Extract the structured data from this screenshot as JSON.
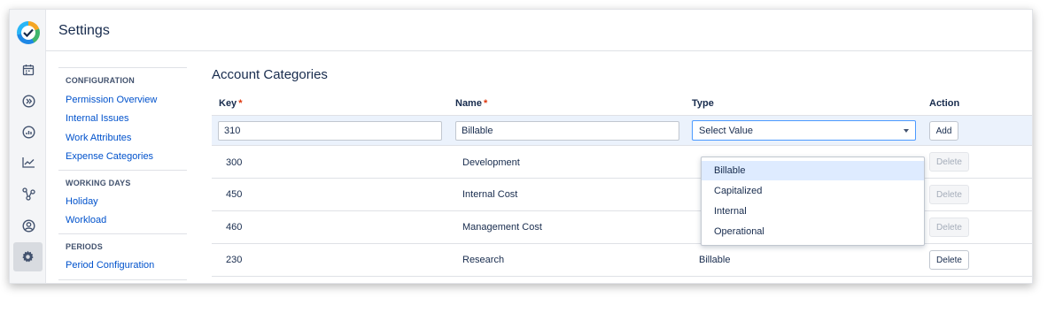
{
  "header": {
    "title": "Settings"
  },
  "rail": {
    "icons": [
      "app-logo",
      "calendar-icon",
      "forward-circle-icon",
      "dashboard-icon",
      "trend-chart-icon",
      "branch-icon",
      "user-circle-icon",
      "gear-icon"
    ],
    "active": "gear-icon"
  },
  "nav": {
    "sections": [
      {
        "title": "CONFIGURATION",
        "links": [
          "Permission Overview",
          "Internal Issues",
          "Work Attributes",
          "Expense Categories"
        ]
      },
      {
        "title": "WORKING DAYS",
        "links": [
          "Holiday",
          "Workload"
        ]
      },
      {
        "title": "PERIODS",
        "links": [
          "Period Configuration"
        ]
      }
    ]
  },
  "main": {
    "title": "Account Categories",
    "columns": {
      "key": "Key",
      "name": "Name",
      "type": "Type",
      "action": "Action"
    },
    "required_mark": "*",
    "new_row": {
      "key_value": "310",
      "name_value": "Billable",
      "type_placeholder": "Select Value",
      "add_label": "Add"
    },
    "rows": [
      {
        "key": "300",
        "name": "Development",
        "type": "",
        "action": "Delete",
        "action_disabled": true
      },
      {
        "key": "450",
        "name": "Internal Cost",
        "type": "",
        "action": "Delete",
        "action_disabled": true
      },
      {
        "key": "460",
        "name": "Management Cost",
        "type": "",
        "action": "Delete",
        "action_disabled": true
      },
      {
        "key": "230",
        "name": "Research",
        "type": "Billable",
        "action": "Delete",
        "action_disabled": false
      }
    ],
    "type_options": [
      "Billable",
      "Capitalized",
      "Internal",
      "Operational"
    ],
    "highlighted_option": "Billable"
  },
  "colors": {
    "link": "#0052cc",
    "required": "#de350b",
    "selected_row": "#ebf2fc",
    "focus_border": "#4c9aff"
  }
}
